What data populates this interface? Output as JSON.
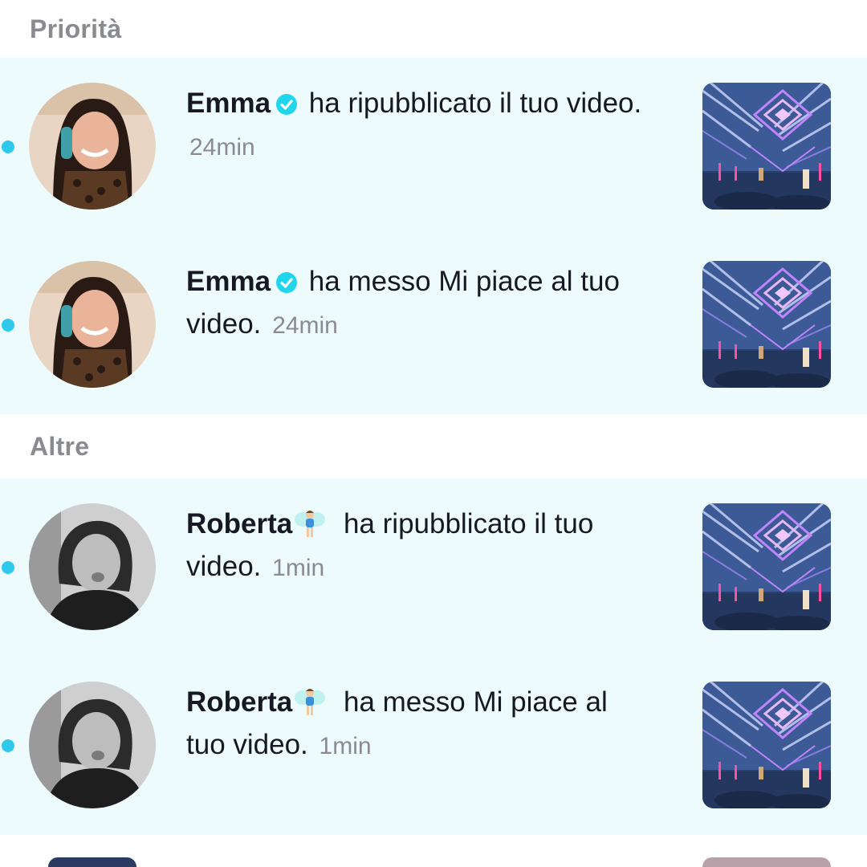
{
  "sections": {
    "priority": {
      "title": "Priorità"
    },
    "others": {
      "title": "Altre"
    }
  },
  "notifications": [
    {
      "username": "Emma",
      "verified": true,
      "action": "ha ripubblicato il tuo video.",
      "time": "24min",
      "unread": true
    },
    {
      "username": "Emma",
      "verified": true,
      "action": "ha messo Mi piace al tuo video.",
      "time": "24min",
      "unread": true
    },
    {
      "username": "Roberta",
      "emoji": "fairy-emoji",
      "action": "ha ripubblicato il tuo video.",
      "time": "1min",
      "unread": true
    },
    {
      "username": "Roberta",
      "emoji": "fairy-emoji",
      "action": "ha messo Mi piace al tuo video.",
      "time": "1min",
      "unread": true
    }
  ],
  "colors": {
    "unread_background": "#eefbfd",
    "unread_dot": "#2ec9ec",
    "verified_badge": "#20d5ec",
    "secondary_text": "#8a8b91"
  },
  "icons": {
    "verified": "verified-badge-icon",
    "fairy": "fairy-emoji"
  }
}
